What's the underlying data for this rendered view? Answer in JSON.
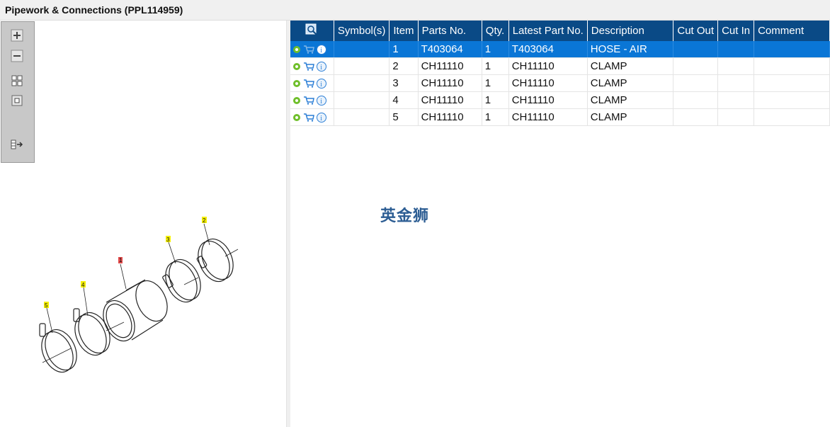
{
  "window": {
    "title": "Pipework & Connections (PPL114959)"
  },
  "toolbar": {
    "buttons": [
      {
        "icon": "zoom-in-icon"
      },
      {
        "icon": "zoom-out-icon"
      },
      {
        "icon": "fit-all-icon"
      },
      {
        "icon": "fit-selection-icon"
      },
      {
        "icon": "export-icon"
      }
    ]
  },
  "diagram": {
    "callouts": [
      {
        "label": "1",
        "color": "#e24a4a"
      },
      {
        "label": "2",
        "color": "#f5f000"
      },
      {
        "label": "3",
        "color": "#f5f000"
      },
      {
        "label": "4",
        "color": "#f5f000"
      },
      {
        "label": "5",
        "color": "#f5f000"
      }
    ]
  },
  "table": {
    "headers": [
      "",
      "Symbol(s)",
      "Item",
      "Parts No.",
      "Qty.",
      "Latest Part No.",
      "Description",
      "Cut Out",
      "Cut In",
      "Comment"
    ],
    "rows": [
      {
        "item": "1",
        "parts_no": "T403064",
        "qty": "1",
        "latest": "T403064",
        "desc": "HOSE - AIR",
        "symbols": "",
        "cut_out": "",
        "cut_in": "",
        "comment": ""
      },
      {
        "item": "2",
        "parts_no": "CH11110",
        "qty": "1",
        "latest": "CH11110",
        "desc": "CLAMP",
        "symbols": "",
        "cut_out": "",
        "cut_in": "",
        "comment": ""
      },
      {
        "item": "3",
        "parts_no": "CH11110",
        "qty": "1",
        "latest": "CH11110",
        "desc": "CLAMP",
        "symbols": "",
        "cut_out": "",
        "cut_in": "",
        "comment": ""
      },
      {
        "item": "4",
        "parts_no": "CH11110",
        "qty": "1",
        "latest": "CH11110",
        "desc": "CLAMP",
        "symbols": "",
        "cut_out": "",
        "cut_in": "",
        "comment": ""
      },
      {
        "item": "5",
        "parts_no": "CH11110",
        "qty": "1",
        "latest": "CH11110",
        "desc": "CLAMP",
        "symbols": "",
        "cut_out": "",
        "cut_in": "",
        "comment": ""
      }
    ]
  },
  "watermark": "英金狮",
  "colors": {
    "header_bg": "#0a4a86",
    "selected_row": "#0a76d6",
    "toolbox_bg": "#c8c8c8"
  }
}
